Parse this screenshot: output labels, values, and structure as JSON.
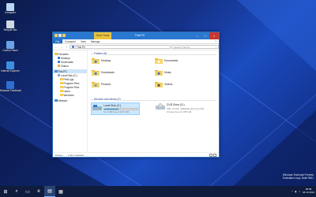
{
  "desktop": {
    "icons": [
      {
        "label": "Computer",
        "icon": "computer-icon",
        "color": "#bcd7f3"
      },
      {
        "label": "Recycle Bin",
        "icon": "recycle-bin-icon",
        "color": "#cfd8e3"
      },
      {
        "label": "Control Panel",
        "icon": "control-panel-icon",
        "color": "#6aa4e6"
      },
      {
        "label": "Internet Explorer",
        "icon": "internet-explorer-icon",
        "color": "#3f8fe0"
      },
      {
        "label": "Windows Feedback",
        "icon": "feedback-icon",
        "color": "#2f6fcf"
      }
    ]
  },
  "window": {
    "contextual_tab": "Drive Tools",
    "title": "This PC",
    "ribbon_tabs": [
      "File",
      "Computer",
      "View",
      "Manage"
    ],
    "help_label": "?",
    "address": "This PC",
    "search_placeholder": "Search This PC",
    "nav": [
      {
        "label": "Favorites",
        "icon": "star-icon",
        "color": "#f0c233",
        "indent": 0
      },
      {
        "label": "Desktop",
        "icon": "desktop-icon",
        "color": "#2f7dd6",
        "indent": 1
      },
      {
        "label": "Downloads",
        "icon": "downloads-icon",
        "color": "#3a86d8",
        "indent": 1
      },
      {
        "label": "Videos",
        "icon": "videos-icon",
        "color": "#e2b54a",
        "indent": 1
      },
      {
        "label": "This PC",
        "icon": "pc-icon",
        "color": "#5a8fd0",
        "indent": 0,
        "selected": true
      },
      {
        "label": "Local Disk (C:)",
        "icon": "drive-icon",
        "color": "#8ea9c6",
        "indent": 1
      },
      {
        "label": "PerfLogs",
        "icon": "folder-icon",
        "color": "#f4cd54",
        "indent": 2
      },
      {
        "label": "Program Files",
        "icon": "folder-icon",
        "color": "#f4cd54",
        "indent": 2
      },
      {
        "label": "Program Files",
        "icon": "folder-icon",
        "color": "#f4cd54",
        "indent": 2
      },
      {
        "label": "Users",
        "icon": "folder-icon",
        "color": "#f4cd54",
        "indent": 2
      },
      {
        "label": "Windows",
        "icon": "folder-icon",
        "color": "#f4cd54",
        "indent": 2
      },
      {
        "label": "Network",
        "icon": "network-icon",
        "color": "#4a8ad8",
        "indent": 0
      }
    ],
    "folders_heading": "Folders (6)",
    "folders": [
      {
        "name": "Desktop",
        "icon": "desktop-folder-icon",
        "accent": "#2f7dd6"
      },
      {
        "name": "Documents",
        "icon": "documents-folder-icon",
        "accent": "#ffffff"
      },
      {
        "name": "Downloads",
        "icon": "downloads-folder-icon",
        "accent": "#2f7dd6"
      },
      {
        "name": "Music",
        "icon": "music-folder-icon",
        "accent": "#3a6fc4"
      },
      {
        "name": "Pictures",
        "icon": "pictures-folder-icon",
        "accent": "#5aa0e0"
      },
      {
        "name": "Videos",
        "icon": "videos-folder-icon",
        "accent": "#4a4a4a"
      }
    ],
    "drives_heading": "Devices and drives (2)",
    "drives": [
      {
        "name": "Local Disk (C:)",
        "free": "11.4 GB free of 19.5 GB",
        "used_fraction": 0.42,
        "icon": "local-disk-icon",
        "selected": true
      },
      {
        "name": "DVD Drive (D:)",
        "free": "JM1_CCSA_X86FRE_EN-US_DV9",
        "free2": "0 bytes free of 2.85 GB",
        "icon": "dvd-drive-icon",
        "selected": false
      }
    ],
    "status_items": "8 items",
    "status_selected": "1 item selected"
  },
  "taskbar": {
    "start_label": "⊞",
    "buttons": [
      {
        "icon": "search-icon",
        "glyph": "⌕"
      },
      {
        "icon": "task-view-icon",
        "glyph": "▭"
      },
      {
        "icon": "internet-explorer-icon",
        "glyph": "e"
      },
      {
        "icon": "file-explorer-icon",
        "glyph": "▤"
      },
      {
        "icon": "store-icon",
        "glyph": "▦"
      }
    ],
    "time": "08:58",
    "date": "06.10.2014"
  },
  "watermark": {
    "line1": "Windows Technical Preview",
    "line2": "Evaluation copy. Build 9841"
  },
  "colors": {
    "title_bar": "#2b78d0",
    "contextual_tab": "#e9c43e",
    "accent": "#1e6fc5",
    "selection": "#cce4f7"
  }
}
